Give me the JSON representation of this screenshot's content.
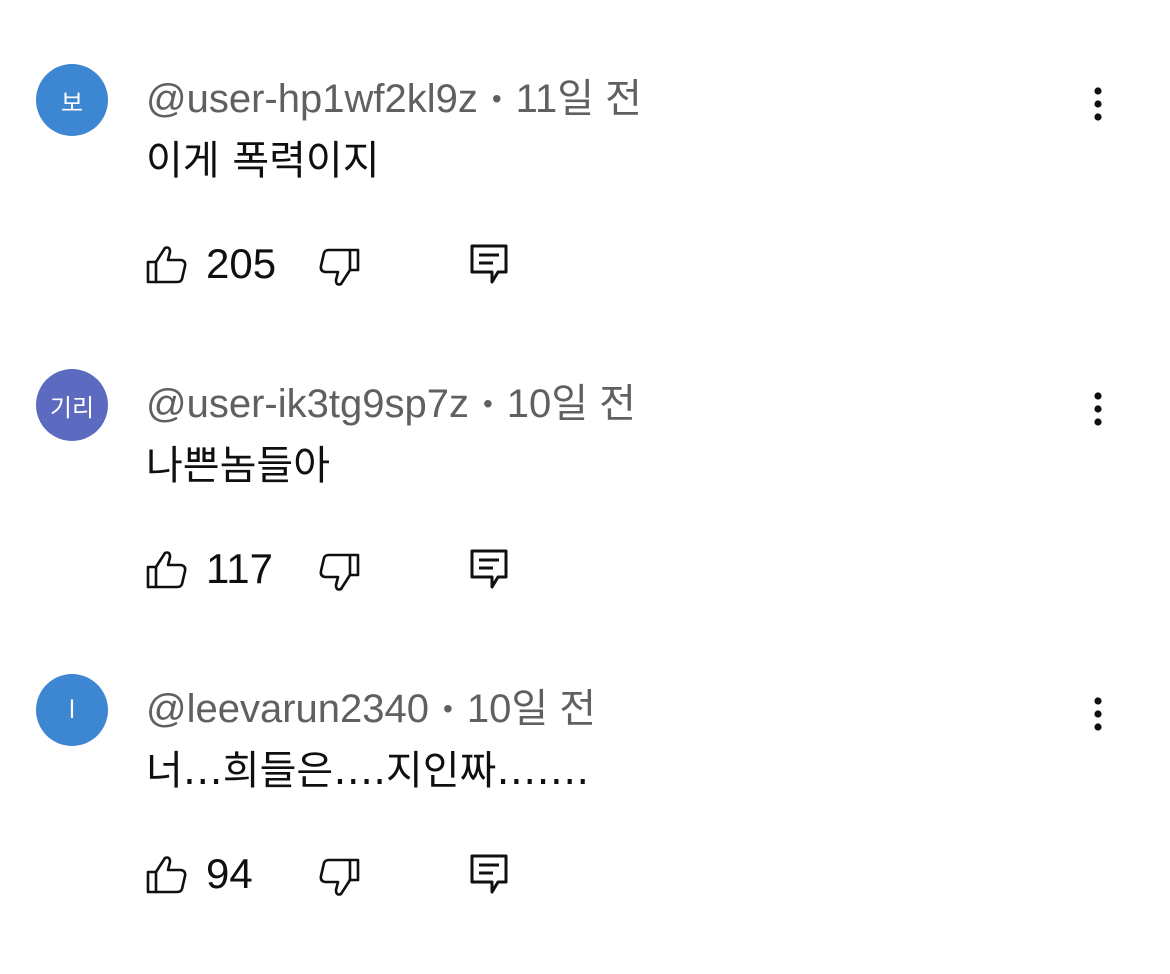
{
  "comments": [
    {
      "avatar_text": "보",
      "avatar_color": "#3d86d2",
      "username": "@user-hp1wf2kl9z",
      "separator": "•",
      "time": "11일 전",
      "text": "이게 폭력이지",
      "likes": "205"
    },
    {
      "avatar_text": "기리",
      "avatar_color": "#5c6bc0",
      "username": "@user-ik3tg9sp7z",
      "separator": "•",
      "time": "10일 전",
      "text": "나쁜놈들아",
      "likes": "117"
    },
    {
      "avatar_text": "l",
      "avatar_color": "#3d86d2",
      "username": "@leevarun2340",
      "separator": "•",
      "time": "10일 전",
      "text": "너…희들은….지인짜…….",
      "likes": "94"
    }
  ],
  "icons": {
    "like": "thumb-up-outline-icon",
    "dislike": "thumb-down-outline-icon",
    "reply": "reply-comment-icon",
    "more": "vertical-dots-icon"
  }
}
